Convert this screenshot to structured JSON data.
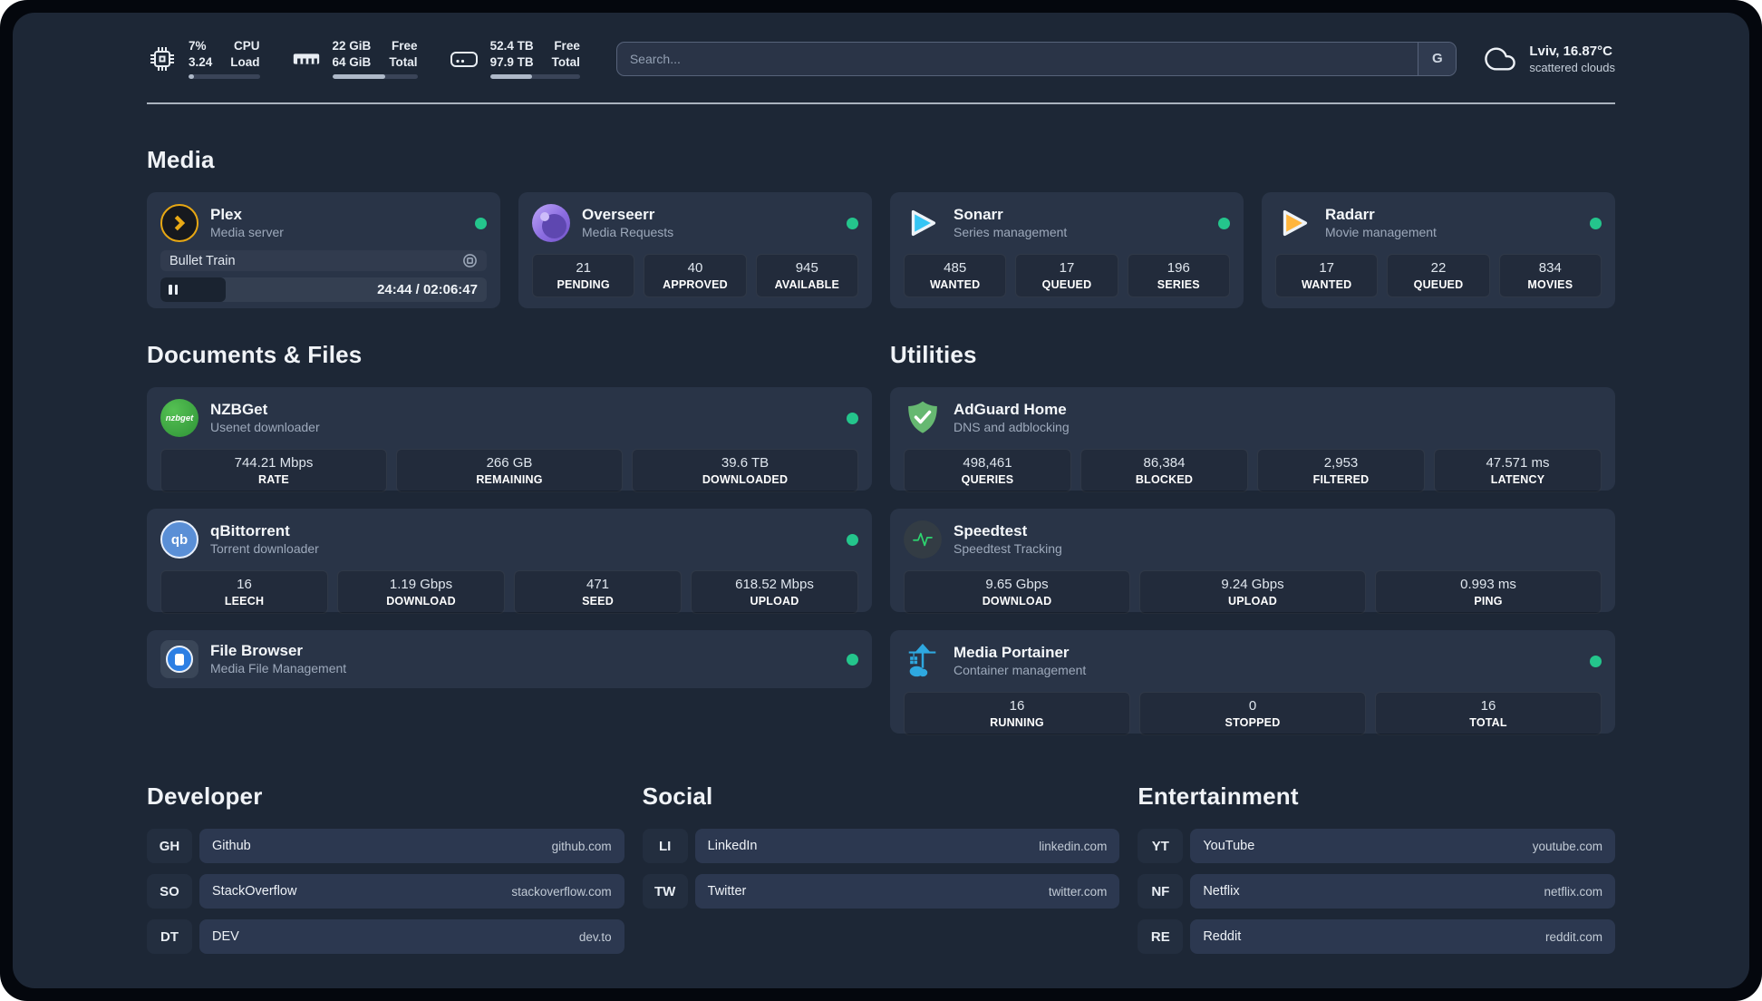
{
  "header": {
    "cpu": {
      "value_top": "7%",
      "value_bottom": "3.24",
      "label_top": "CPU",
      "label_bottom": "Load",
      "progress_pct": 8
    },
    "memory": {
      "value_top": "22 GiB",
      "value_bottom": "64 GiB",
      "label_top": "Free",
      "label_bottom": "Total",
      "progress_pct": 62
    },
    "disk": {
      "value_top": "52.4 TB",
      "value_bottom": "97.9 TB",
      "label_top": "Free",
      "label_bottom": "Total",
      "progress_pct": 47
    },
    "search": {
      "placeholder": "Search...",
      "provider_label": "G"
    },
    "weather": {
      "location": "Lviv, 16.87°C",
      "condition": "scattered clouds"
    }
  },
  "media": {
    "heading": "Media",
    "plex": {
      "title": "Plex",
      "subtitle": "Media server",
      "now_playing": "Bullet Train",
      "time": "24:44 / 02:06:47",
      "progress_pct": 20
    },
    "overseerr": {
      "title": "Overseerr",
      "subtitle": "Media Requests",
      "stats": [
        {
          "value": "21",
          "label": "PENDING"
        },
        {
          "value": "40",
          "label": "APPROVED"
        },
        {
          "value": "945",
          "label": "AVAILABLE"
        }
      ]
    },
    "sonarr": {
      "title": "Sonarr",
      "subtitle": "Series management",
      "stats": [
        {
          "value": "485",
          "label": "WANTED"
        },
        {
          "value": "17",
          "label": "QUEUED"
        },
        {
          "value": "196",
          "label": "SERIES"
        }
      ]
    },
    "radarr": {
      "title": "Radarr",
      "subtitle": "Movie management",
      "stats": [
        {
          "value": "17",
          "label": "WANTED"
        },
        {
          "value": "22",
          "label": "QUEUED"
        },
        {
          "value": "834",
          "label": "MOVIES"
        }
      ]
    }
  },
  "documents": {
    "heading": "Documents & Files",
    "nzbget": {
      "title": "NZBGet",
      "subtitle": "Usenet downloader",
      "logo_text": "nzbget",
      "stats": [
        {
          "value": "744.21 Mbps",
          "label": "RATE"
        },
        {
          "value": "266 GB",
          "label": "REMAINING"
        },
        {
          "value": "39.6 TB",
          "label": "DOWNLOADED"
        }
      ]
    },
    "qbittorrent": {
      "title": "qBittorrent",
      "subtitle": "Torrent downloader",
      "logo_text": "qb",
      "stats": [
        {
          "value": "16",
          "label": "LEECH"
        },
        {
          "value": "1.19 Gbps",
          "label": "DOWNLOAD"
        },
        {
          "value": "471",
          "label": "SEED"
        },
        {
          "value": "618.52 Mbps",
          "label": "UPLOAD"
        }
      ]
    },
    "filebrowser": {
      "title": "File Browser",
      "subtitle": "Media File Management"
    }
  },
  "utilities": {
    "heading": "Utilities",
    "adguard": {
      "title": "AdGuard Home",
      "subtitle": "DNS and adblocking",
      "stats": [
        {
          "value": "498,461",
          "label": "QUERIES"
        },
        {
          "value": "86,384",
          "label": "BLOCKED"
        },
        {
          "value": "2,953",
          "label": "FILTERED"
        },
        {
          "value": "47.571 ms",
          "label": "LATENCY"
        }
      ]
    },
    "speedtest": {
      "title": "Speedtest",
      "subtitle": "Speedtest Tracking",
      "stats": [
        {
          "value": "9.65 Gbps",
          "label": "DOWNLOAD"
        },
        {
          "value": "9.24 Gbps",
          "label": "UPLOAD"
        },
        {
          "value": "0.993 ms",
          "label": "PING"
        }
      ]
    },
    "portainer": {
      "title": "Media Portainer",
      "subtitle": "Container management",
      "stats": [
        {
          "value": "16",
          "label": "RUNNING"
        },
        {
          "value": "0",
          "label": "STOPPED"
        },
        {
          "value": "16",
          "label": "TOTAL"
        }
      ]
    }
  },
  "bookmarks": {
    "developer": {
      "heading": "Developer",
      "links": [
        {
          "abbr": "GH",
          "name": "Github",
          "domain": "github.com"
        },
        {
          "abbr": "SO",
          "name": "StackOverflow",
          "domain": "stackoverflow.com"
        },
        {
          "abbr": "DT",
          "name": "DEV",
          "domain": "dev.to"
        }
      ]
    },
    "social": {
      "heading": "Social",
      "links": [
        {
          "abbr": "LI",
          "name": "LinkedIn",
          "domain": "linkedin.com"
        },
        {
          "abbr": "TW",
          "name": "Twitter",
          "domain": "twitter.com"
        }
      ]
    },
    "entertainment": {
      "heading": "Entertainment",
      "links": [
        {
          "abbr": "YT",
          "name": "YouTube",
          "domain": "youtube.com"
        },
        {
          "abbr": "NF",
          "name": "Netflix",
          "domain": "netflix.com"
        },
        {
          "abbr": "RE",
          "name": "Reddit",
          "domain": "reddit.com"
        }
      ]
    }
  },
  "colors": {
    "status_online": "#24c58c",
    "plex_accent": "#e7a713",
    "sonarr_accent": "#35c5f4",
    "radarr_accent": "#ffb53c",
    "nzbget_accent": "#3aa93f",
    "adguard_accent": "#66b871",
    "qbittorrent_accent": "#5a8fd6",
    "portainer_accent": "#2ea8e0",
    "speedtest_accent": "#2dd36f"
  }
}
